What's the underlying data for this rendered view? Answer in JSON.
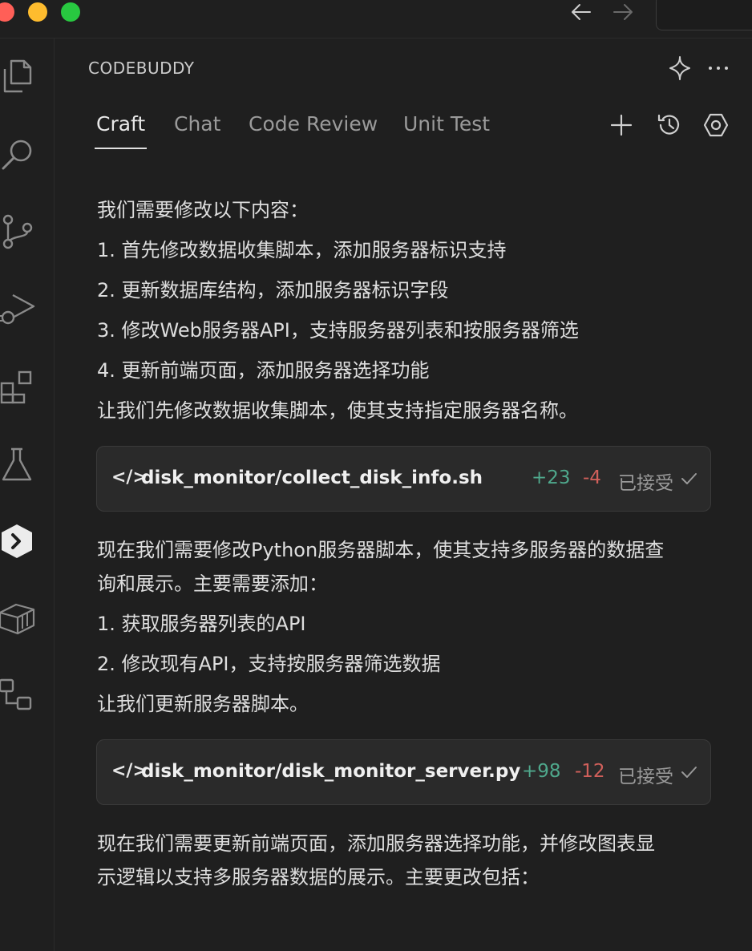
{
  "panel": {
    "title": "CODEBUDDY",
    "tabs": [
      {
        "label": "Craft"
      },
      {
        "label": "Chat"
      },
      {
        "label": "Code Review"
      },
      {
        "label": "Unit Test"
      }
    ]
  },
  "messages": {
    "block1": [
      "我们需要修改以下内容：",
      "1. 首先修改数据收集脚本，添加服务器标识支持",
      "2. 更新数据库结构，添加服务器标识字段",
      "3. 修改Web服务器API，支持服务器列表和按服务器筛选",
      "4. 更新前端页面，添加服务器选择功能",
      "让我们先修改数据收集脚本，使其支持指定服务器名称。"
    ],
    "file1": {
      "code_icon": "</>",
      "name": "disk_monitor/collect_disk_info.sh",
      "additions": "+23",
      "deletions": "-4",
      "status": "已接受"
    },
    "block2": [
      "现在我们需要修改Python服务器脚本，使其支持多服务器的数据查",
      "询和展示。主要需要添加：",
      "1. 获取服务器列表的API",
      "2. 修改现有API，支持按服务器筛选数据",
      "让我们更新服务器脚本。"
    ],
    "file2": {
      "code_icon": "</>",
      "name": "disk_monitor/disk_monitor_server.py",
      "additions": "+98",
      "deletions": "-12",
      "status": "已接受"
    },
    "block3": [
      "现在我们需要更新前端页面，添加服务器选择功能，并修改图表显",
      "示逻辑以支持多服务器数据的展示。主要更改包括："
    ]
  },
  "colors": {
    "additions": "#4fa88c",
    "deletions": "#d1605b",
    "background": "#1f1f1f",
    "card": "#2a2a2a"
  }
}
